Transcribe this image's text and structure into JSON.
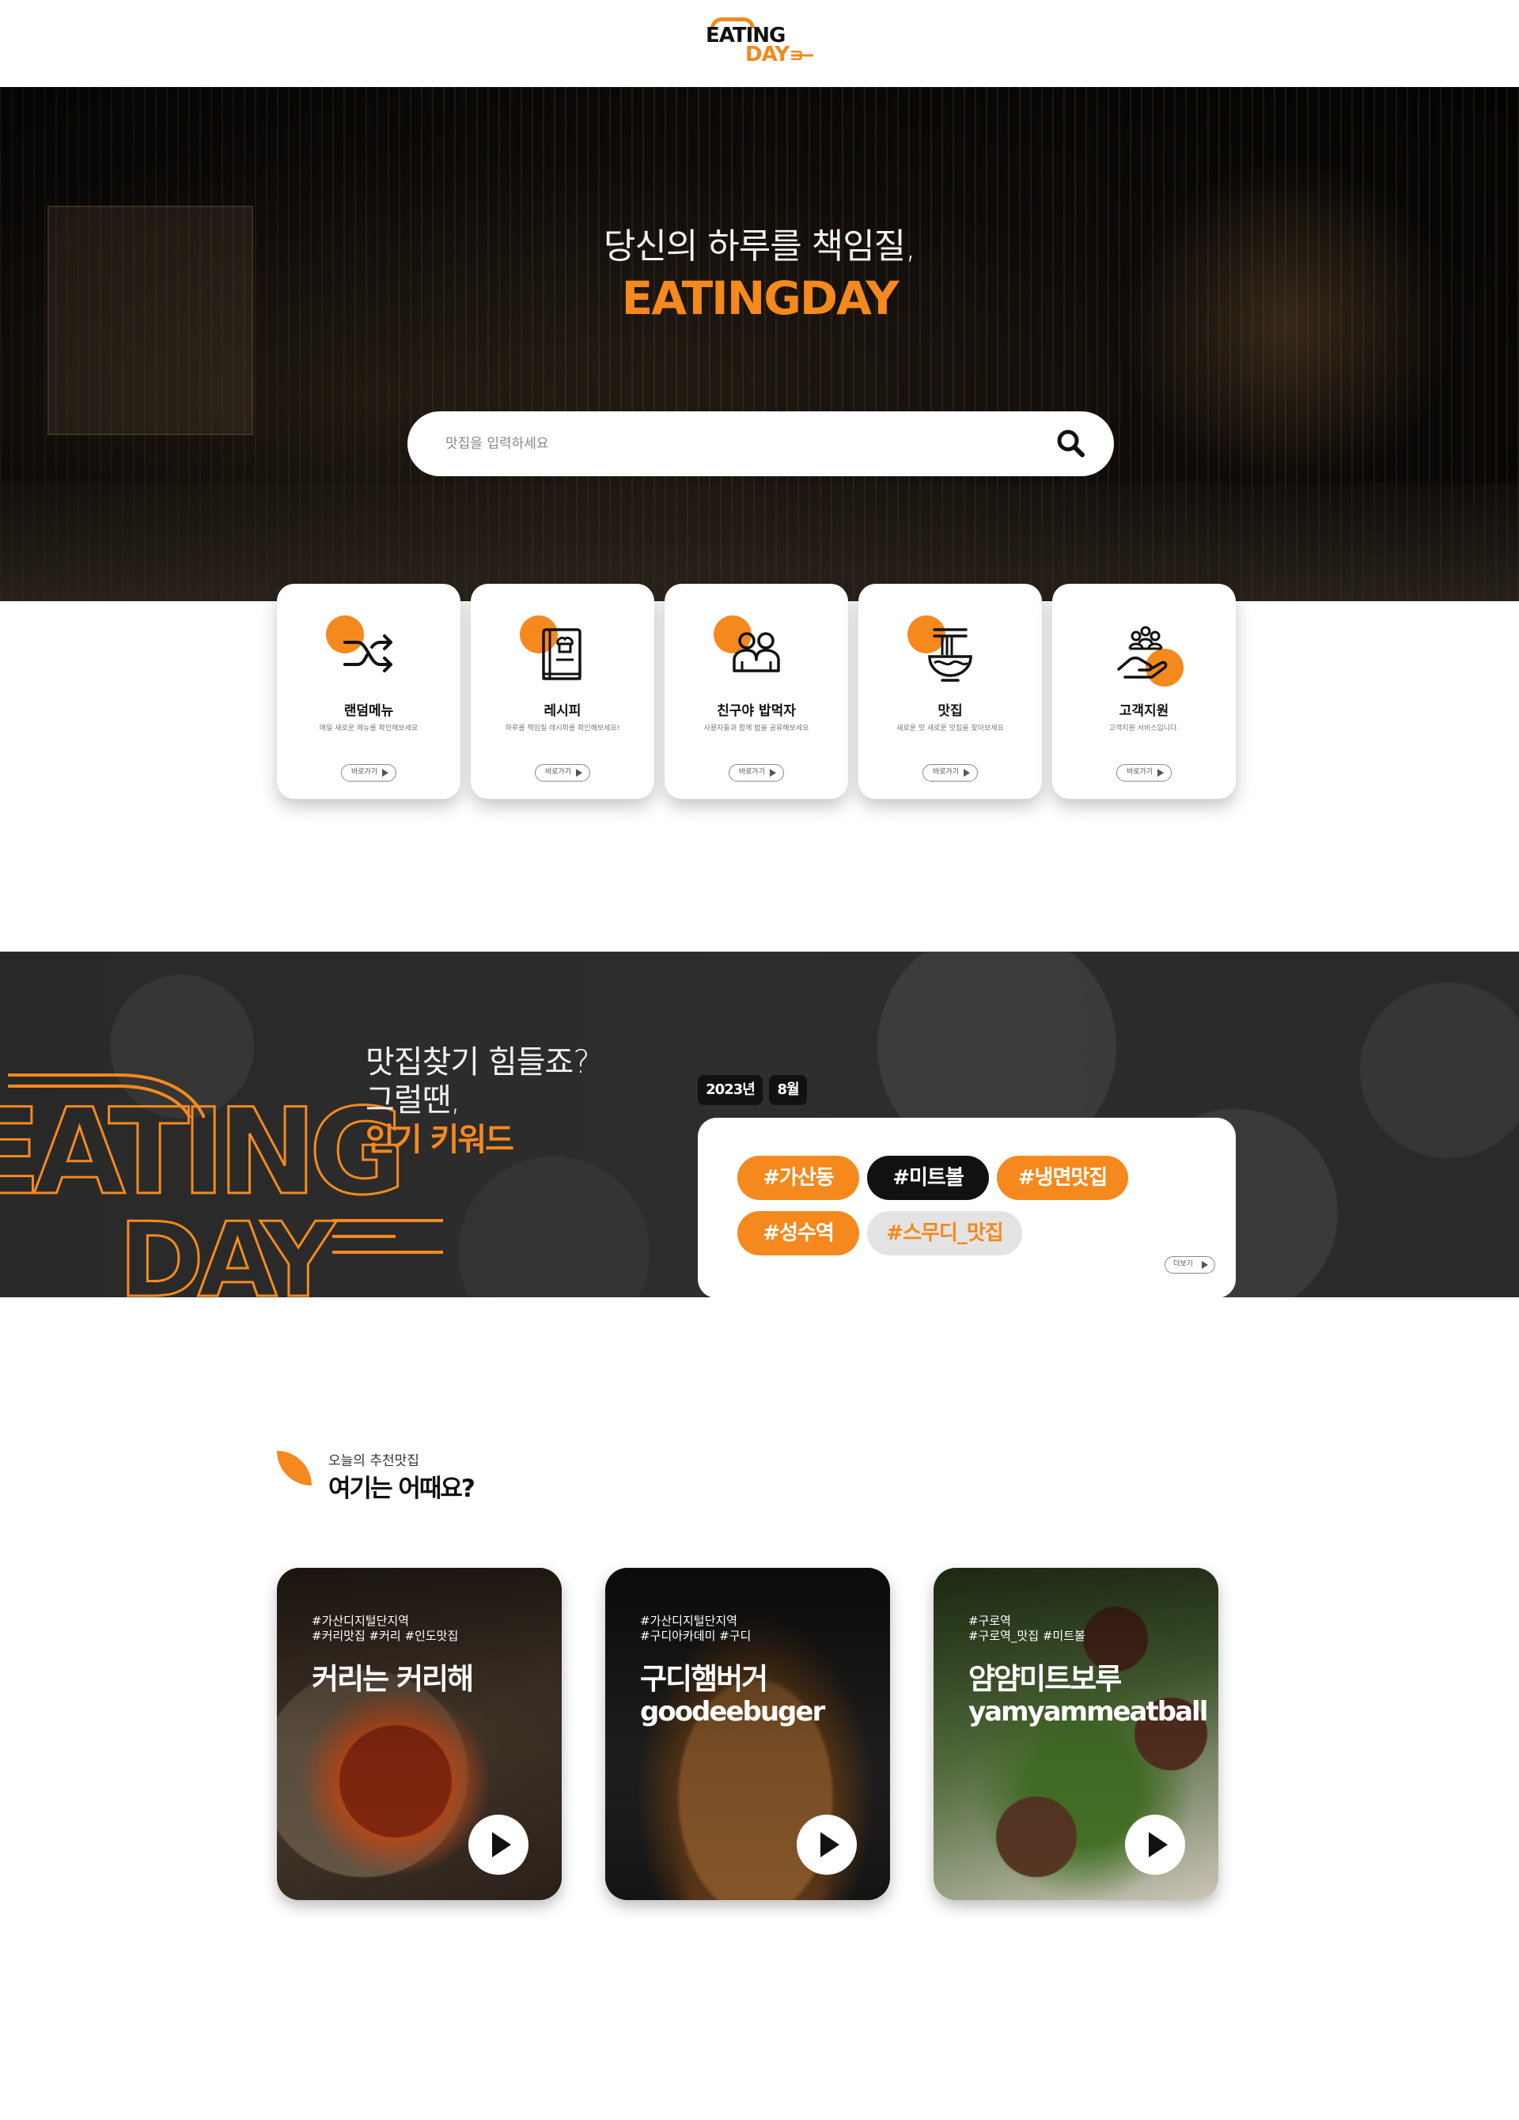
{
  "header": {
    "logo_line1": "EATING",
    "logo_line2": "DAY"
  },
  "hero": {
    "subtitle": "당신의 하루를 책임질,",
    "title": "EATINGDAY",
    "search_placeholder": "맛집을 입력하세요"
  },
  "quick_menu": [
    {
      "title": "랜덤메뉴",
      "desc": "매일 새로운 메뉴를 확인해보세요",
      "button": "바로가기",
      "icon": "shuffle-icon"
    },
    {
      "title": "레시피",
      "desc": "하루를 책임질 레시피를 확인해보세요!",
      "button": "바로가기",
      "icon": "recipe-book-icon"
    },
    {
      "title": "친구야 밥먹자",
      "desc": "사용자들과 함께 밥을 공유해보세요",
      "button": "바로가기",
      "icon": "friends-icon"
    },
    {
      "title": "맛집",
      "desc": "새로운 맛 새로운 맛집을 찾아보세요",
      "button": "바로가기",
      "icon": "noodle-bowl-icon"
    },
    {
      "title": "고객지원",
      "desc": "고객지원 서비스입니다.",
      "button": "바로가기",
      "icon": "customer-support-icon"
    }
  ],
  "keywords": {
    "line1": "맛집찾기 힘들죠?",
    "line2": "그럴땐,",
    "line3": "인기 키워드",
    "year": "2023년",
    "month": "8월",
    "tags": [
      "#가산동",
      "#미트볼",
      "#냉면맛집",
      "#성수역",
      "#스무디_맛집"
    ],
    "more_button": "더보기",
    "outline_logo_line1": "EATING",
    "outline_logo_line2": "DAY"
  },
  "recommend": {
    "subtitle": "오늘의 추천맛집",
    "title": "여기는 어때요?",
    "cards": [
      {
        "tags": "#가산디지털단지역\n#커리맛집 #커리 #인도맛집",
        "name": "커리는 커리해",
        "eng": ""
      },
      {
        "tags": "#가산디지털단지역\n#구디아카데미 #구디",
        "name": "구디햄버거",
        "eng": "goodeebuger"
      },
      {
        "tags": "#구로역\n#구로역_맛집 #미트볼",
        "name": "얌얌미트보루",
        "eng": "yamyammeatball"
      }
    ]
  },
  "colors": {
    "accent": "#f5891e",
    "dark": "#111111",
    "tag_gray": "#e3e3e3"
  }
}
